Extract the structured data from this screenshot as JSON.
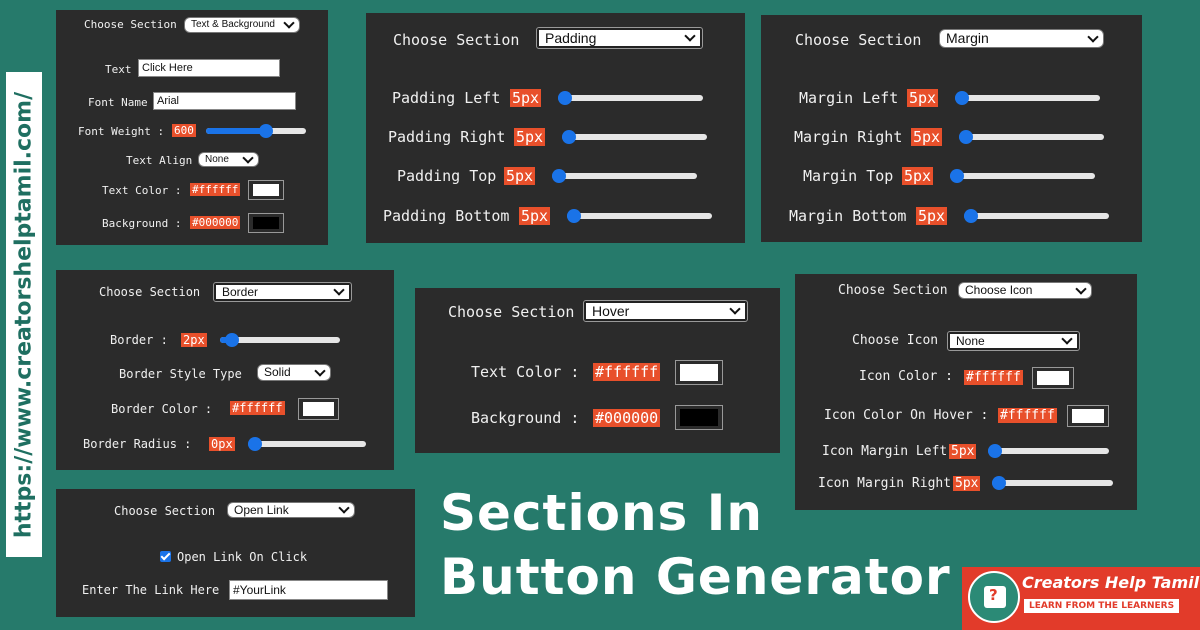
{
  "site_url": "https://www.creatorshelptamil.com/",
  "heading": {
    "line1": "Sections In",
    "line2": "Button Generator"
  },
  "brand": {
    "name": "Creators Help Tamil",
    "tagline": "LEARN FROM THE LEARNERS"
  },
  "colors": {
    "background": "#267a6b",
    "panel": "#2b2b2b",
    "badge": "#e8502b",
    "slider": "#1a73e8",
    "brand": "#e23b2a"
  },
  "text_bg": {
    "choose_label": "Choose Section",
    "select_value": "Text & Background",
    "text_label": "Text",
    "text_value": "Click Here",
    "font_name_label": "Font Name",
    "font_name_value": "Arial",
    "font_weight_label": "Font Weight :",
    "font_weight_value": "600",
    "font_weight_fraction": 0.6,
    "text_align_label": "Text Align",
    "text_align_value": "None",
    "text_color_label": "Text Color :",
    "text_color_value": "#ffffff",
    "background_label": "Background :",
    "background_value": "#000000"
  },
  "padding": {
    "choose_label": "Choose Section",
    "select_value": "Padding",
    "rows": [
      {
        "label": "Padding Left",
        "value": "5px",
        "fraction": 0.05
      },
      {
        "label": "Padding Right",
        "value": "5px",
        "fraction": 0.05
      },
      {
        "label": "Padding Top",
        "value": "5px",
        "fraction": 0.05
      },
      {
        "label": "Padding Bottom",
        "value": "5px",
        "fraction": 0.05
      }
    ]
  },
  "margin": {
    "choose_label": "Choose Section",
    "select_value": "Margin",
    "rows": [
      {
        "label": "Margin Left",
        "value": "5px",
        "fraction": 0.05
      },
      {
        "label": "Margin Right",
        "value": "5px",
        "fraction": 0.05
      },
      {
        "label": "Margin Top",
        "value": "5px",
        "fraction": 0.05
      },
      {
        "label": "Margin Bottom",
        "value": "5px",
        "fraction": 0.05
      }
    ]
  },
  "border": {
    "choose_label": "Choose Section",
    "select_value": "Border",
    "border_label": "Border :",
    "border_value": "2px",
    "border_fraction": 0.1,
    "style_label": "Border Style Type",
    "style_value": "Solid",
    "color_label": "Border Color :",
    "color_value": "#ffffff",
    "radius_label": "Border Radius :",
    "radius_value": "0px",
    "radius_fraction": 0
  },
  "hover": {
    "choose_label": "Choose Section",
    "select_value": "Hover",
    "text_color_label": "Text Color :",
    "text_color_value": "#ffffff",
    "background_label": "Background :",
    "background_value": "#000000"
  },
  "icon": {
    "choose_label": "Choose Section",
    "select_value": "Choose Icon",
    "icon_label": "Choose Icon",
    "icon_value": "None",
    "color_label": "Icon Color :",
    "color_value": "#ffffff",
    "hover_label": "Icon Color On Hover :",
    "hover_value": "#ffffff",
    "margin_left_label": "Icon Margin Left",
    "margin_left_value": "5px",
    "margin_left_fraction": 0.05,
    "margin_right_label": "Icon Margin Right",
    "margin_right_value": "5px",
    "margin_right_fraction": 0.05
  },
  "link": {
    "choose_label": "Choose Section",
    "select_value": "Open Link",
    "checkbox_label": "Open Link On Click",
    "checked": true,
    "link_label": "Enter The Link Here",
    "link_value": "#YourLink"
  }
}
